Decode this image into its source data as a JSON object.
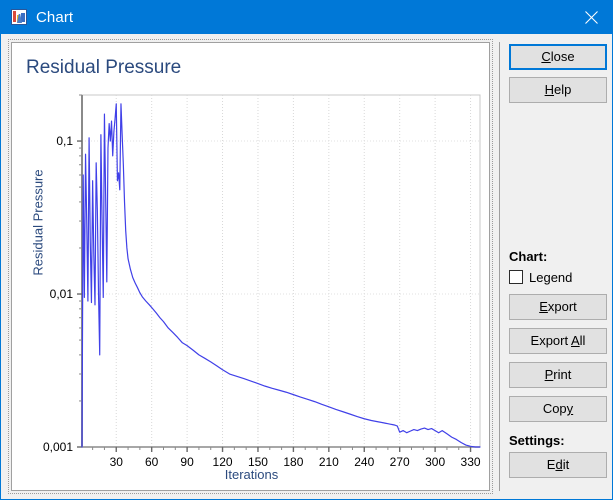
{
  "window": {
    "title": "Chart",
    "icon": "chart-app-icon",
    "close_icon": "close-icon",
    "titlebar_color": "#0078d7"
  },
  "chart_panel": {
    "title": "Residual Pressure"
  },
  "sidepane": {
    "close_label": "Close",
    "close_accel": "C",
    "help_label": "Help",
    "help_accel": "H",
    "chart_group_label": "Chart:",
    "legend_checkbox_label": "Legend",
    "legend_checked": false,
    "export_label": "Export",
    "export_accel": "E",
    "export_all_label": "Export All",
    "export_all_accel": "A",
    "print_label": "Print",
    "print_accel": "P",
    "copy_label": "Copy",
    "copy_accel": "y",
    "settings_group_label": "Settings:",
    "edit_label": "Edit",
    "edit_accel": "d"
  },
  "chart_data": {
    "type": "line",
    "title": "Residual Pressure",
    "xlabel": "Iterations",
    "ylabel": "Residual Pressure",
    "yscale": "log",
    "xlim": [
      1,
      338
    ],
    "ylim": [
      0.001,
      0.2
    ],
    "grid": true,
    "legend": false,
    "legend_position": "none",
    "line_color": "#4040e8",
    "title_color": "#2b4a7e",
    "axis_label_color": "#2b4a7e",
    "decimal_separator": ",",
    "xticks": [
      30,
      60,
      90,
      120,
      150,
      180,
      210,
      240,
      270,
      300,
      330
    ],
    "xtick_labels": [
      "30",
      "60",
      "90",
      "120",
      "150",
      "180",
      "210",
      "240",
      "270",
      "300",
      "330"
    ],
    "yticks": [
      0.1,
      0.01,
      0.001
    ],
    "ytick_labels": [
      "0,1",
      "0,01",
      "0,001"
    ],
    "series": [
      {
        "name": "Residual Pressure",
        "x": [
          1,
          2,
          3,
          4,
          5,
          6,
          7,
          8,
          9,
          10,
          11,
          12,
          13,
          14,
          15,
          16,
          17,
          18,
          19,
          20,
          21,
          22,
          23,
          24,
          25,
          26,
          27,
          28,
          29,
          30,
          31,
          32,
          33,
          34,
          35,
          36,
          37,
          38,
          39,
          40,
          42,
          44,
          46,
          48,
          50,
          52,
          55,
          58,
          61,
          64,
          67,
          70,
          74,
          78,
          82,
          86,
          90,
          95,
          100,
          105,
          110,
          115,
          120,
          126,
          132,
          138,
          144,
          150,
          156,
          162,
          168,
          174,
          180,
          186,
          192,
          198,
          204,
          210,
          216,
          222,
          228,
          234,
          240,
          246,
          252,
          256,
          258,
          260,
          262,
          264,
          266,
          268,
          270,
          273,
          276,
          279,
          282,
          285,
          288,
          291,
          294,
          297,
          300,
          303,
          306,
          310,
          314,
          318,
          322,
          326,
          330,
          334,
          338
        ],
        "y": [
          0.001,
          0.06,
          0.0095,
          0.082,
          0.03,
          0.009,
          0.105,
          0.022,
          0.0088,
          0.055,
          0.018,
          0.0085,
          0.072,
          0.035,
          0.01,
          0.004,
          0.11,
          0.03,
          0.0095,
          0.15,
          0.045,
          0.012,
          0.09,
          0.13,
          0.1,
          0.135,
          0.08,
          0.115,
          0.14,
          0.175,
          0.055,
          0.062,
          0.048,
          0.175,
          0.11,
          0.07,
          0.04,
          0.026,
          0.02,
          0.017,
          0.0145,
          0.0128,
          0.0118,
          0.011,
          0.0102,
          0.0096,
          0.009,
          0.0085,
          0.008,
          0.0075,
          0.007,
          0.0066,
          0.006,
          0.0056,
          0.0052,
          0.0048,
          0.0046,
          0.0043,
          0.004,
          0.0038,
          0.0036,
          0.0034,
          0.0032,
          0.003,
          0.0029,
          0.0028,
          0.0027,
          0.0026,
          0.0025,
          0.00242,
          0.00235,
          0.00228,
          0.0022,
          0.00212,
          0.00205,
          0.00198,
          0.0019,
          0.00183,
          0.00176,
          0.0017,
          0.00164,
          0.00158,
          0.00153,
          0.00149,
          0.00146,
          0.00144,
          0.00143,
          0.00142,
          0.00141,
          0.0014,
          0.00139,
          0.00137,
          0.00125,
          0.00128,
          0.00124,
          0.00127,
          0.0013,
          0.00128,
          0.00131,
          0.00133,
          0.0013,
          0.00132,
          0.00128,
          0.00124,
          0.00128,
          0.00122,
          0.00116,
          0.00112,
          0.00107,
          0.00103,
          0.00101,
          0.001,
          0.001,
          0.001
        ]
      }
    ]
  }
}
